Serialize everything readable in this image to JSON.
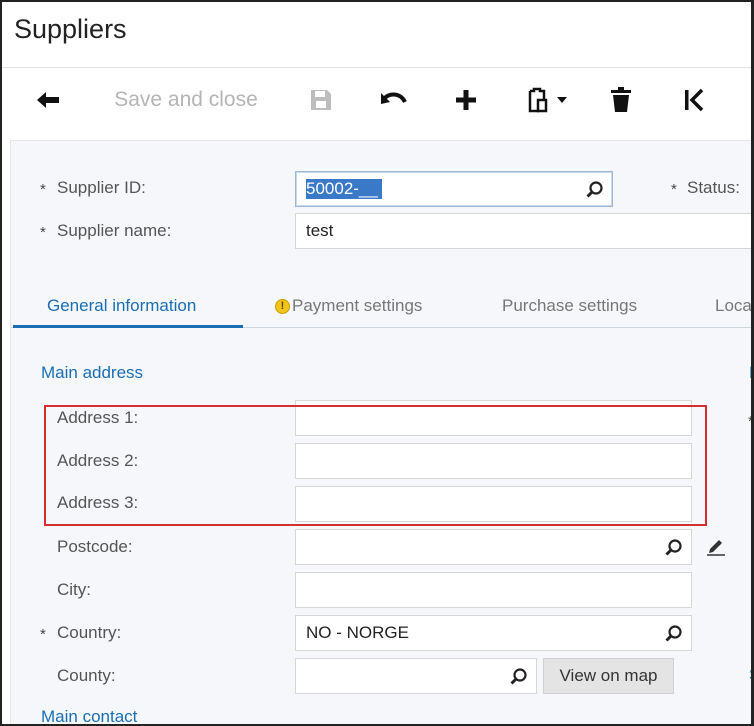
{
  "page": {
    "title": "Suppliers"
  },
  "toolbar": {
    "back_icon": "arrow-left-icon",
    "save_close_label": "Save and close",
    "save_icon": "floppy-disk-icon",
    "undo_icon": "undo-icon",
    "add_icon": "plus-icon",
    "clipboard_icon": "clipboard-paste-icon",
    "clipboard_dropdown_icon": "caret-down-icon",
    "delete_icon": "trash-icon",
    "first_icon": "first-record-icon"
  },
  "header_form": {
    "supplier_id": {
      "required_mark": "*",
      "label": "Supplier ID:",
      "value": "50002-__"
    },
    "supplier_name": {
      "required_mark": "*",
      "label": "Supplier name:",
      "value": "test"
    },
    "status": {
      "required_mark": "*",
      "label": "Status:"
    }
  },
  "tabs": [
    {
      "label": "General information",
      "active": true
    },
    {
      "label": "Payment settings",
      "warning": true,
      "warning_glyph": "!"
    },
    {
      "label": "Purchase settings"
    },
    {
      "label": "Loca"
    }
  ],
  "main_address": {
    "section_title": "Main address",
    "fields": {
      "address1": {
        "label": "Address 1:",
        "value": ""
      },
      "address2": {
        "label": "Address 2:",
        "value": ""
      },
      "address3": {
        "label": "Address 3:",
        "value": ""
      },
      "postcode": {
        "label": "Postcode:",
        "value": ""
      },
      "city": {
        "label": "City:",
        "value": ""
      },
      "country": {
        "required_mark": "*",
        "label": "Country:",
        "value": "NO - NORGE"
      },
      "county": {
        "label": "County:",
        "value": ""
      }
    },
    "view_on_map_label": "View on map"
  },
  "main_contact": {
    "section_title": "Main contact"
  },
  "right_edge": {
    "clipped_header": "F",
    "clipped_required": "*",
    "clipped_label": "S"
  },
  "colors": {
    "accent": "#1a6eb5",
    "highlight_border": "#d32f2f",
    "selection": "#3a78c8"
  }
}
